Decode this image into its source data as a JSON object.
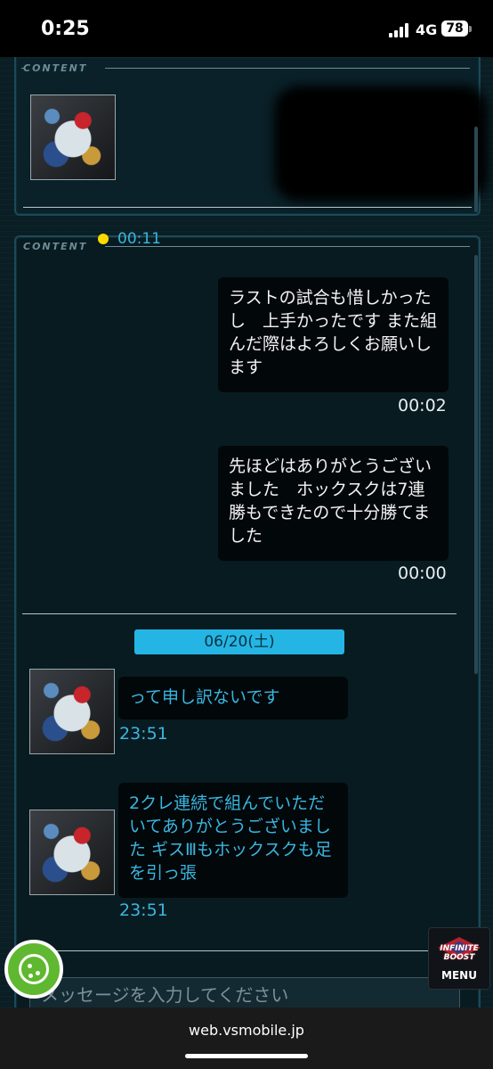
{
  "status_bar": {
    "time": "0:25",
    "network": "4G",
    "battery": "78"
  },
  "content_label": "CONTENT",
  "conversation": {
    "partial_timestamp": "00:11",
    "messages_out": [
      {
        "text": "ラストの試合も惜しかったし　上手かったです\nまた組んだ際はよろしくお願いします",
        "time": "00:02"
      },
      {
        "text": "先ほどはありがとうございました　ホックスクは7連勝もできたので十分勝てました",
        "time": "00:00"
      }
    ],
    "date_separator": "06/20(土)",
    "messages_in": [
      {
        "text": "って申し訳ないです",
        "time": "23:51"
      },
      {
        "text": "2クレ連続で組んでいただいてありがとうございました ギスⅢもホックスクも足を引っ張",
        "time": "23:51"
      }
    ]
  },
  "menu": {
    "logo_text": "INFINITE BOOST",
    "label": "MENU"
  },
  "input": {
    "placeholder": "メッセージを入力してください"
  },
  "browser": {
    "url": "web.vsmobile.jp"
  },
  "icons": [
    "cookie-icon",
    "cellular-signal-icon",
    "battery-icon",
    "menu-logo-icon"
  ],
  "colors": {
    "accent": "#25b5e5",
    "incoming_text": "#3ab6df",
    "cookie": "#5fb82f"
  }
}
